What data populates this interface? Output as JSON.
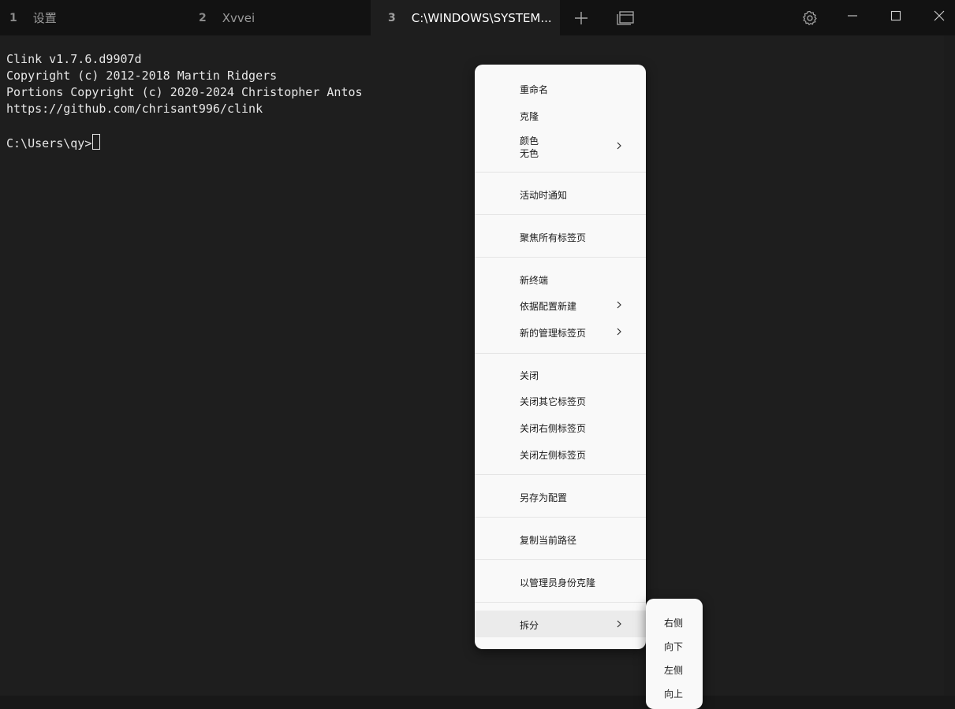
{
  "tabs": [
    {
      "num": "1",
      "title": "设置"
    },
    {
      "num": "2",
      "title": "Xvvei"
    },
    {
      "num": "3",
      "title": "C:\\WINDOWS\\SYSTEM..."
    }
  ],
  "titlebar_icons": [
    "plus-icon",
    "tab-switcher-icon",
    "gear-icon",
    "minimize-icon",
    "maximize-icon",
    "close-icon"
  ],
  "terminal": {
    "lines": [
      "Clink v1.7.6.d9907d",
      "Copyright (c) 2012-2018 Martin Ridgers",
      "Portions Copyright (c) 2020-2024 Christopher Antos",
      "https://github.com/chrisant996/clink"
    ],
    "prompt": "C:\\Users\\qy>"
  },
  "menu": {
    "rename": "重命名",
    "duplicate": "克隆",
    "color": "颜色",
    "color_value": "无色",
    "notify_on_activity": "活动时通知",
    "focus_all_tabs": "聚焦所有标签页",
    "new_terminal": "新终端",
    "new_from_profile": "依据配置新建",
    "new_admin_tab": "新的管理标签页",
    "close": "关闭",
    "close_other_tabs": "关闭其它标签页",
    "close_tabs_right": "关闭右侧标签页",
    "close_tabs_left": "关闭左侧标签页",
    "save_as_profile": "另存为配置",
    "copy_current_path": "复制当前路径",
    "duplicate_as_admin": "以管理员身份克隆",
    "split": "拆分"
  },
  "submenu": {
    "right": "右侧",
    "down": "向下",
    "left": "左侧",
    "up": "向上"
  },
  "colors": {
    "titlebar": "#121212",
    "terminal_bg": "#1e1e1e",
    "menu_bg": "#f9f9f9",
    "menu_highlight": "#ebebeb"
  }
}
